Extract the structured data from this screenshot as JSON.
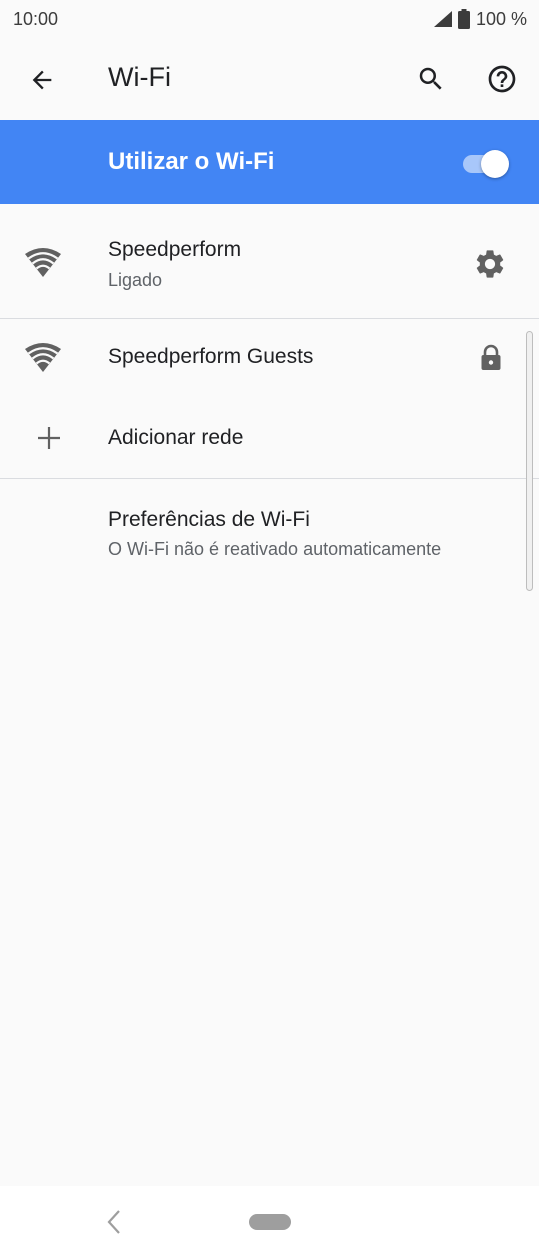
{
  "status_bar": {
    "time": "10:00",
    "battery": "100 %",
    "icons": [
      "signal-icon",
      "battery-icon"
    ]
  },
  "app_bar": {
    "title": "Wi-Fi",
    "icons": [
      "arrow-back-icon",
      "search-icon",
      "help-icon"
    ]
  },
  "master_switch": {
    "label": "Utilizar o Wi-Fi",
    "enabled": true,
    "color": "#4285f4"
  },
  "connected_network": {
    "name": "Speedperform",
    "status": "Ligado",
    "icons": [
      "wifi-icon",
      "gear-icon"
    ]
  },
  "networks": [
    {
      "name": "Speedperform Guests",
      "icons": [
        "wifi-icon",
        "lock-icon"
      ]
    }
  ],
  "add_network": {
    "label": "Adicionar rede",
    "icon": "plus-icon"
  },
  "preferences": {
    "title": "Preferências de Wi-Fi",
    "summary": "O Wi-Fi não é reativado automaticamente"
  },
  "nav_bar": {
    "icons": [
      "nav-back-icon",
      "home-pill-icon"
    ]
  }
}
